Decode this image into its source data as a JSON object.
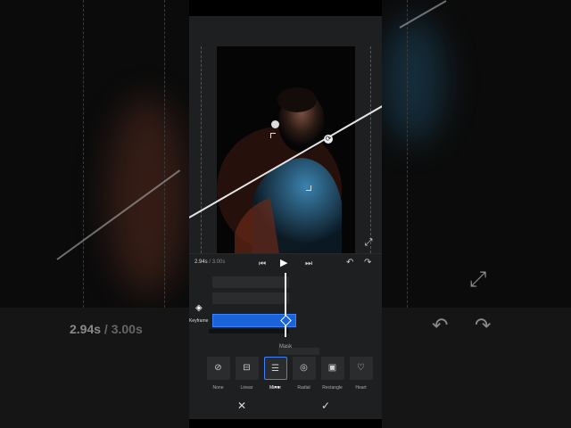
{
  "playback": {
    "current_time": "2.94s",
    "separator": " / ",
    "total_time": "3.00s"
  },
  "timeline": {
    "keyframe_label": "Keyframe"
  },
  "mask_panel": {
    "title": "Mask",
    "options": [
      {
        "label": "None",
        "icon": "none-icon",
        "glyph": "⊘"
      },
      {
        "label": "Linear",
        "icon": "linear-icon",
        "glyph": "⊟"
      },
      {
        "label": "Mirror",
        "icon": "mirror-icon",
        "glyph": "☰",
        "selected": true
      },
      {
        "label": "Radial",
        "icon": "radial-icon",
        "glyph": "◎"
      },
      {
        "label": "Rectangle",
        "icon": "rectangle-icon",
        "glyph": "▣"
      },
      {
        "label": "Heart",
        "icon": "heart-icon",
        "glyph": "♡"
      }
    ]
  },
  "colors": {
    "accent": "#1b63d8",
    "panel_bg": "#1e1f21"
  }
}
